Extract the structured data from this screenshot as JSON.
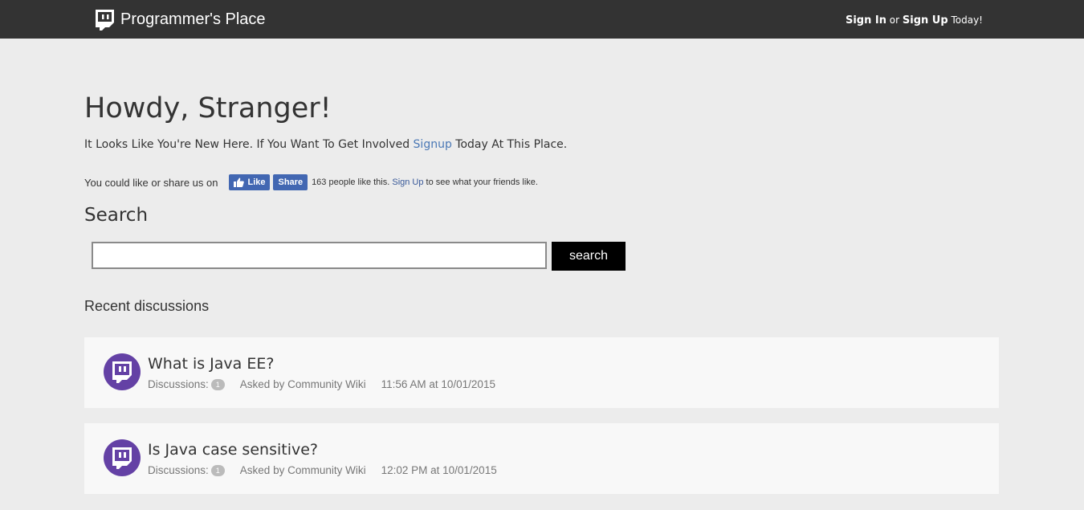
{
  "header": {
    "brand_name": "Programmer's Place",
    "brand_icon": "twitch-chat-icon",
    "sign_in": "Sign In",
    "or_text": " or ",
    "sign_up": "Sign Up",
    "today_text": " Today!"
  },
  "hero": {
    "greeting": "Howdy, Stranger!",
    "intro_before": "It Looks Like You're New Here. If You Want To Get Involved ",
    "intro_link": "Signup",
    "intro_after": " Today At This Place."
  },
  "share": {
    "text": "You could like or share us on",
    "like_label": "Like",
    "share_label": "Share",
    "count_text": "163 people like this. ",
    "signup_link": "Sign Up",
    "count_after": " to see what your friends like."
  },
  "search": {
    "heading": "Search",
    "input_value": "",
    "button_label": "search"
  },
  "recent": {
    "heading": "Recent discussions",
    "items": [
      {
        "title": "What is Java EE?",
        "discussions_label": "Discussions:",
        "count": "1",
        "asked_by": "Asked by Community Wiki",
        "time": "11:56 AM at 10/01/2015"
      },
      {
        "title": "Is Java case sensitive?",
        "discussions_label": "Discussions:",
        "count": "1",
        "asked_by": "Asked by Community Wiki",
        "time": "12:02 PM at 10/01/2015"
      }
    ]
  },
  "colors": {
    "topbar": "#333333",
    "link": "#4a78b5",
    "facebook": "#4267b2",
    "avatar": "#6441a5"
  }
}
